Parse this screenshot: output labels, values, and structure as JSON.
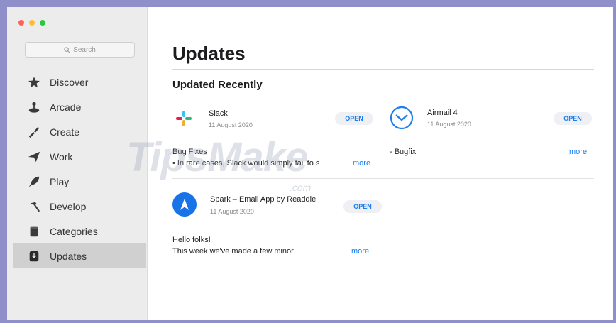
{
  "window": {
    "traffic_colors": [
      "#ff5f57",
      "#febc2e",
      "#28c840"
    ]
  },
  "search": {
    "placeholder": "Search",
    "icon": "magnifier-icon"
  },
  "sidebar": {
    "items": [
      {
        "label": "Discover",
        "icon": "star-icon"
      },
      {
        "label": "Arcade",
        "icon": "joystick-icon"
      },
      {
        "label": "Create",
        "icon": "brush-icon"
      },
      {
        "label": "Work",
        "icon": "paper-plane-icon"
      },
      {
        "label": "Play",
        "icon": "rocket-icon"
      },
      {
        "label": "Develop",
        "icon": "hammer-icon"
      },
      {
        "label": "Categories",
        "icon": "box-icon"
      },
      {
        "label": "Updates",
        "icon": "download-icon",
        "active": true
      }
    ]
  },
  "main": {
    "title": "Updates",
    "section_title": "Updated Recently",
    "apps": [
      {
        "name": "Slack",
        "date": "11 August 2020",
        "button": "OPEN",
        "notes": [
          "Bug Fixes",
          "• In rare cases, Slack would simply fail to s"
        ],
        "more": "more"
      },
      {
        "name": "Airmail 4",
        "date": "11 August 2020",
        "button": "OPEN",
        "notes": [
          "- Bugfix"
        ],
        "more": "more"
      },
      {
        "name": "Spark – Email App by Readdle",
        "date": "11 August 2020",
        "button": "OPEN",
        "notes": [
          "Hello folks!",
          "This week we've made a few minor"
        ],
        "more": "more"
      }
    ]
  },
  "watermark": {
    "text": "TipsMake",
    "suffix": ".com"
  },
  "colors": {
    "accent": "#1a7cf0",
    "sidebar_bg": "#ececec",
    "frame": "#8f8fc9"
  }
}
